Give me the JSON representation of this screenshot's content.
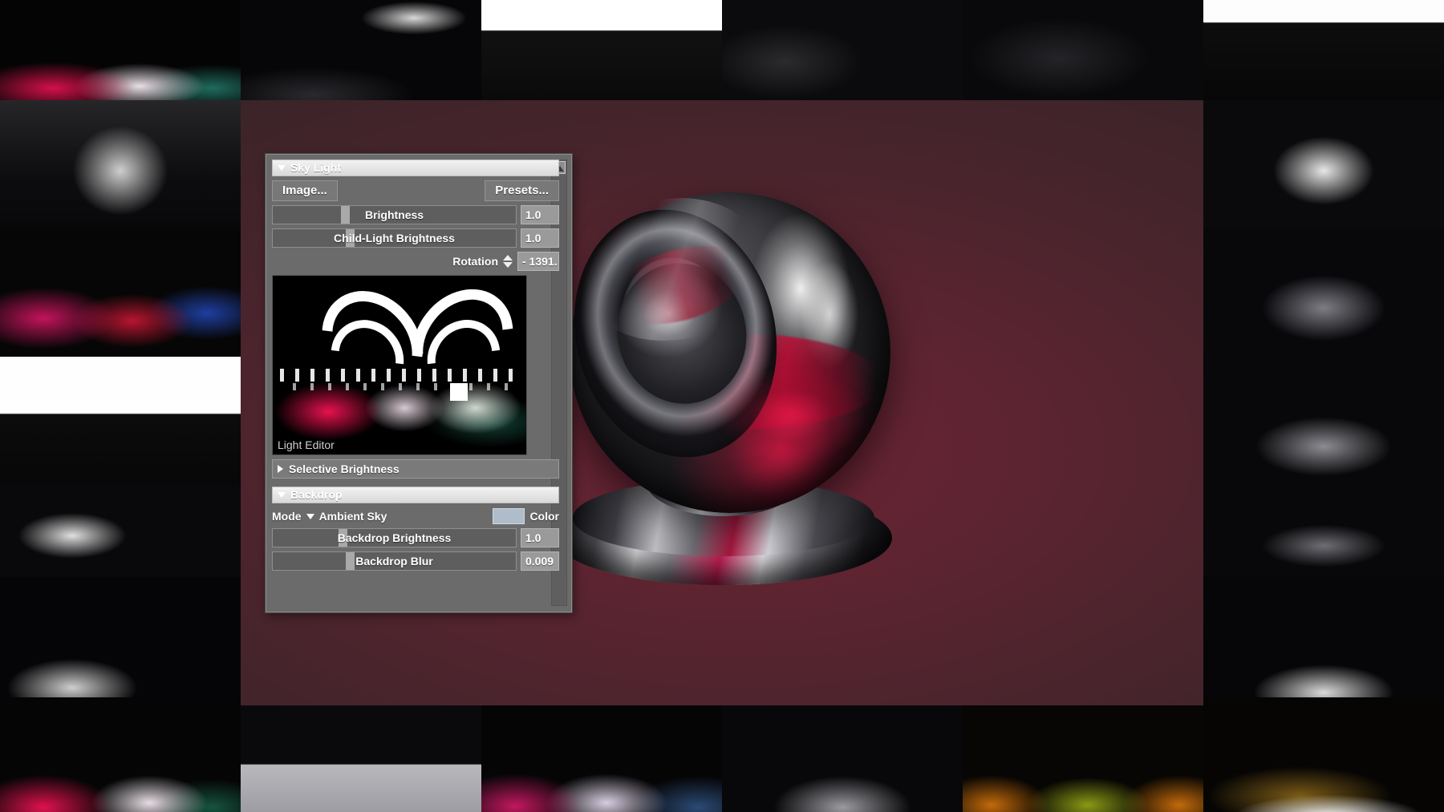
{
  "app": {
    "viewport_background": "#5b2430",
    "panel_background": "#6b6b6b"
  },
  "panel": {
    "scrollbar": {
      "up_arrow_icon": "triangle-up-icon"
    },
    "sky_light": {
      "title": "Sky Light",
      "expanded": true,
      "disclosure_icon": "triangle-down-icon",
      "image_button": "Image...",
      "presets_button": "Presets...",
      "brightness": {
        "label": "Brightness",
        "value": "1.0",
        "handle_pct": 28
      },
      "child_light_brightness": {
        "label": "Child-Light Brightness",
        "value": "1.0",
        "handle_pct": 30
      },
      "rotation": {
        "label": "Rotation",
        "value": "- 1391.",
        "spinner_up_icon": "triangle-up-icon",
        "spinner_down_icon": "triangle-down-icon"
      },
      "light_editor": {
        "caption": "Light Editor"
      },
      "selective_brightness": {
        "label": "Selective Brightness",
        "expanded": false,
        "disclosure_icon": "triangle-right-icon"
      }
    },
    "backdrop": {
      "title": "Backdrop",
      "expanded": true,
      "disclosure_icon": "triangle-down-icon",
      "mode": {
        "label": "Mode",
        "dropdown_icon": "triangle-down-icon",
        "value": "Ambient Sky"
      },
      "color": {
        "label": "Color",
        "swatch_hex": "#aebdc9"
      },
      "backdrop_brightness": {
        "label": "Backdrop Brightness",
        "value": "1.0",
        "handle_pct": 27
      },
      "backdrop_blur": {
        "label": "Backdrop Blur",
        "value": "0.009",
        "handle_pct": 30
      }
    }
  },
  "hdri_grid": {
    "description": "Grid of HDRI environment map thumbnails",
    "thumbnails": [
      {
        "name": "studio-magenta-floor",
        "tone": "magenta"
      },
      {
        "name": "dark-corridor-neon",
        "tone": "mono"
      },
      {
        "name": "white-dome-arches",
        "tone": "highkey"
      },
      {
        "name": "dark-dome-arches",
        "tone": "mono"
      },
      {
        "name": "dark-dome-grid",
        "tone": "mono"
      },
      {
        "name": "white-window-bays",
        "tone": "highkey"
      },
      {
        "name": "chrome-tunnel",
        "tone": "mono"
      },
      {
        "name": "theatre-hall",
        "tone": "mono"
      },
      {
        "name": "stage-red-blue",
        "tone": "red"
      },
      {
        "name": "arc-lights-dark",
        "tone": "mono"
      },
      {
        "name": "soft-arch-white",
        "tone": "highkey"
      },
      {
        "name": "night-floor-strips",
        "tone": "mono"
      },
      {
        "name": "spot-floor-white",
        "tone": "mono"
      },
      {
        "name": "strip-array-dark",
        "tone": "mono"
      },
      {
        "name": "studio-softbox",
        "tone": "mono"
      },
      {
        "name": "red-magenta-studio",
        "tone": "magenta"
      },
      {
        "name": "grey-studio-floor",
        "tone": "mono"
      },
      {
        "name": "violet-studio",
        "tone": "violet"
      },
      {
        "name": "amber-green-floor",
        "tone": "warm"
      },
      {
        "name": "tungsten-lamp-stage",
        "tone": "warm"
      }
    ]
  }
}
